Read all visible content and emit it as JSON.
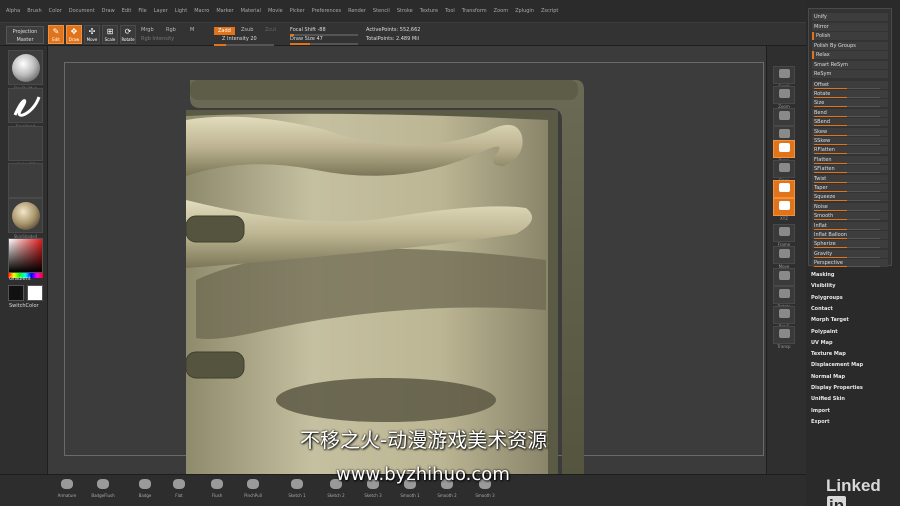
{
  "menu": [
    "Alpha",
    "Brush",
    "Color",
    "Document",
    "Draw",
    "Edit",
    "File",
    "Layer",
    "Light",
    "Macro",
    "Marker",
    "Material",
    "Movie",
    "Picker",
    "Preferences",
    "Render",
    "Stencil",
    "Stroke",
    "Texture",
    "Tool",
    "Transform",
    "Zoom",
    "Zplugin",
    "Zscript"
  ],
  "toolbar": {
    "projection_master": "Projection Master",
    "edit": "Edit",
    "draw": "Draw",
    "move": "Move",
    "scale": "Scale",
    "rotate": "Rotate",
    "mrgb": "Mrgb",
    "rgb": "Rgb",
    "m": "M",
    "rgb_intensity": "Rgb Intensity",
    "zadd": "Zadd",
    "zsub": "Zsub",
    "zcut": "Zcut",
    "z_intensity": "Z Intensity 20",
    "focal_shift": "Focal Shift -88",
    "draw_size": "Draw Size 47",
    "active_points": "ActivePoints: 552,662",
    "total_points": "TotalPoints: 2.489 Mil"
  },
  "left_shelf": {
    "brush": "ClayBuildup",
    "stroke": "FreeHand",
    "alpha": "Alpha Off",
    "texture": "Texture Off",
    "material": "SkinShade4",
    "gradient": "Gradient",
    "switch_color": "SwitchColor"
  },
  "right_shelf": [
    "Scroll",
    "Zoom",
    "Actual",
    "AAHalf",
    "Persp",
    "Floor",
    "Local",
    "XYZ",
    "Frame",
    "Move",
    "Scale",
    "Rotate",
    "PolyF",
    "Transp"
  ],
  "deformation": {
    "top_items": [
      "Unify",
      "Mirror",
      "Polish",
      "Polish By Groups",
      "Relax",
      "Smart ReSym",
      "ReSym"
    ],
    "rows": [
      {
        "label": "Offset",
        "fill": 0.5
      },
      {
        "label": "Rotate",
        "fill": 0.5
      },
      {
        "label": "Size",
        "fill": 0.5
      },
      {
        "label": "Bend",
        "fill": 0.5
      },
      {
        "label": "SBend",
        "fill": 0.5
      },
      {
        "label": "Skew",
        "fill": 0.5
      },
      {
        "label": "SSkew",
        "fill": 0.5
      },
      {
        "label": "RFlatten",
        "fill": 0.5
      },
      {
        "label": "Flatten",
        "fill": 0.5
      },
      {
        "label": "SFlatten",
        "fill": 0.5
      },
      {
        "label": "Twist",
        "fill": 0.5
      },
      {
        "label": "Taper",
        "fill": 0.5
      },
      {
        "label": "Squeeze",
        "fill": 0.5
      },
      {
        "label": "Noise",
        "fill": 0.5
      },
      {
        "label": "Smooth",
        "fill": 0.5
      },
      {
        "label": "Inflat",
        "fill": 0.5
      },
      {
        "label": "Inflat Balloon",
        "fill": 0.5
      },
      {
        "label": "Spherize",
        "fill": 0.5
      },
      {
        "label": "Gravity",
        "fill": 0.5
      },
      {
        "label": "Perspective",
        "fill": 0.5
      }
    ]
  },
  "subpalettes": [
    "Masking",
    "Visibility",
    "Polygroups",
    "Contact",
    "Morph Target",
    "Polypaint",
    "UV Map",
    "Texture Map",
    "Displacement Map",
    "Normal Map",
    "Display Properties",
    "Unified Skin",
    "Import",
    "Export"
  ],
  "bottom_brushes": [
    "Armature",
    "BadgeFlush",
    "Badge",
    "Flat",
    "Flush",
    "PinchPull",
    "Sketch 1",
    "Sketch 2",
    "Sketch 3",
    "Smooth 1",
    "Smooth 2",
    "Smooth 3"
  ],
  "watermark_cn": "不移之火-动漫游戏美术资源",
  "watermark_url": "www.byzhihuo.com",
  "brand": {
    "text": "Linked",
    "box": "in"
  },
  "colors": {
    "accent": "#e0741c"
  }
}
